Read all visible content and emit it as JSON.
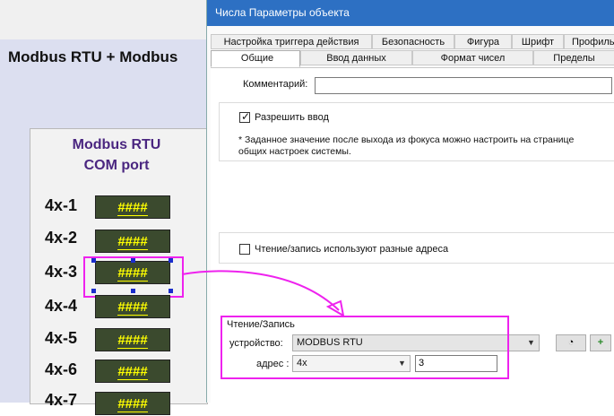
{
  "background": {
    "title": "Modbus RTU + Modbus",
    "panel_title_line1": "Modbus RTU",
    "panel_title_line2": "COM port",
    "rows": [
      {
        "label": "4x-1",
        "value": "####"
      },
      {
        "label": "4x-2",
        "value": "####"
      },
      {
        "label": "4x-3",
        "value": "####"
      },
      {
        "label": "4x-4",
        "value": "####"
      },
      {
        "label": "4x-5",
        "value": "####"
      },
      {
        "label": "4x-6",
        "value": "####"
      },
      {
        "label": "4x-7",
        "value": "####"
      }
    ]
  },
  "dialog": {
    "title": "Числа Параметры объекта",
    "tabs_row1": [
      "Настройка триггера действия",
      "Безопасность",
      "Фигура",
      "Шрифт",
      "Профиль"
    ],
    "tabs_row2": [
      "Общие",
      "Ввод данных",
      "Формат чисел",
      "Пределы"
    ],
    "selected_tab": "Общие",
    "comment_label": "Комментарий:",
    "comment_value": "",
    "allow_input_label": "Разрешить ввод",
    "allow_input_checked": true,
    "note_line1": "* Заданное значение после выхода из фокуса можно настроить на странице",
    "note_line2": "общих настроек системы.",
    "rw_diff_label": "Чтение/запись используют разные адреса",
    "rw_diff_checked": false,
    "rw_group_label": "Чтение/Запись",
    "device_label": "устройство:",
    "device_value": "MODBUS RTU",
    "address_label": "адрес :",
    "address_type": "4x",
    "address_value": "3"
  },
  "colors": {
    "annotation": "#ee22ee",
    "titlebar": "#2d70c3",
    "display_bg": "#3b4a2e",
    "display_text": "#ffff00"
  }
}
